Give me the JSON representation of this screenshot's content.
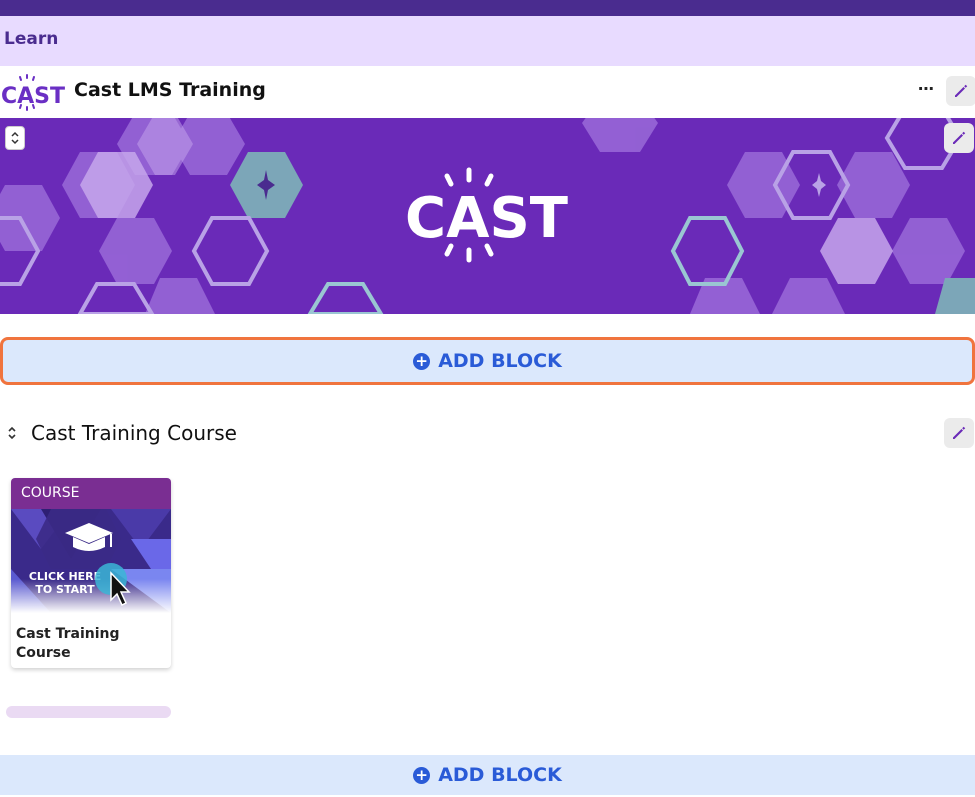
{
  "learn_bar": {
    "title": "Learn"
  },
  "header": {
    "logo_text": "CAST",
    "site_title": "Cast LMS Training",
    "more_label": "⋯"
  },
  "banner": {
    "logo_text": "CAST"
  },
  "add_block": {
    "label": "ADD BLOCK",
    "icon": "+"
  },
  "section": {
    "title": "Cast Training Course",
    "reorder_icon": "⌃⌄"
  },
  "course_card": {
    "type_label": "COURSE",
    "image_text_line1": "CLICK HERE",
    "image_text_line2": "TO START",
    "name": "Cast Training Course"
  },
  "colors": {
    "top_bar": "#4a2c8f",
    "learn_bar": "#e8dbff",
    "brand_purple": "#6a2ab8",
    "add_block_bg": "#dbe8fc",
    "add_block_text": "#2a5bd7",
    "focus_outline": "#f0743e"
  }
}
